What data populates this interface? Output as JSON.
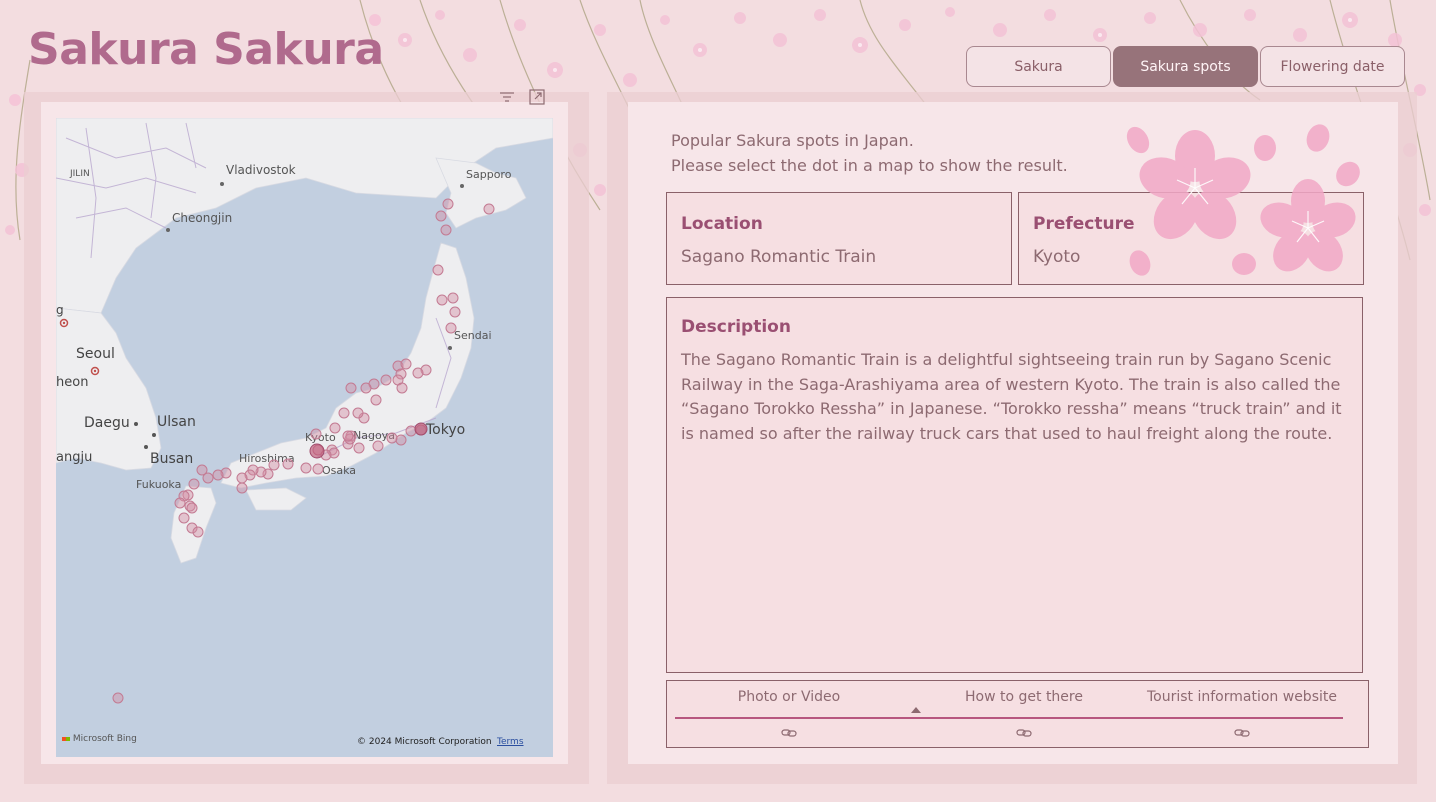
{
  "app": {
    "title": "Sakura Sakura"
  },
  "tabs": [
    {
      "label": "Sakura",
      "active": false
    },
    {
      "label": "Sakura spots",
      "active": true
    },
    {
      "label": "Flowering date",
      "active": false
    }
  ],
  "visual_header": {
    "icons": [
      "filter-icon",
      "focus-mode-icon"
    ]
  },
  "map": {
    "labels": {
      "jilin": "JILIN",
      "vladivostok": "Vladivostok",
      "sapporo": "Sapporo",
      "cheongjin": "Cheongjin",
      "seoul": "Seoul",
      "incheon": "heon",
      "sendai": "Sendai",
      "daegu": "Daegu",
      "ulsan": "Ulsan",
      "busan": "Busan",
      "gwangju": "angju",
      "kyoto": "Kyoto",
      "nagoya": "Nagoya",
      "tokyo": "Tokyo",
      "hiroshima": "Hiroshima",
      "osaka": "Osaka",
      "fukuoka": "Fukuoka",
      "edge_g": "g"
    },
    "provider": "Microsoft Bing",
    "copyright": "© 2024 Microsoft Corporation",
    "terms": "Terms"
  },
  "details": {
    "intro_line1": "Popular Sakura spots in Japan.",
    "intro_line2": "Please select the dot in a map to show the result.",
    "location_label": "Location",
    "location_value": "Sagano Romantic Train",
    "prefecture_label": "Prefecture",
    "prefecture_value": "Kyoto",
    "description_label": "Description",
    "description_text": "The Sagano Romantic Train is a delightful sightseeing train run by Sagano Scenic Railway in the Saga-Arashiyama area of western Kyoto. The train is also called the “Sagano Torokko Ressha” in Japanese. “Torokko ressha” means “truck train” and it is named so after the railway truck cars that used to haul freight along the route."
  },
  "links_table": {
    "columns": [
      "Photo or Video",
      "How to get there",
      "Tourist information website"
    ],
    "row_icons": [
      "link-icon",
      "link-icon",
      "link-icon"
    ]
  },
  "colors": {
    "background": "#f3dde0",
    "title": "#b06a8d",
    "active_tab": "#97737a",
    "card_border": "#8a6169",
    "label_accent": "#9a4f72",
    "map_water": "#c2cfe0",
    "dot": "#d38fa5"
  }
}
